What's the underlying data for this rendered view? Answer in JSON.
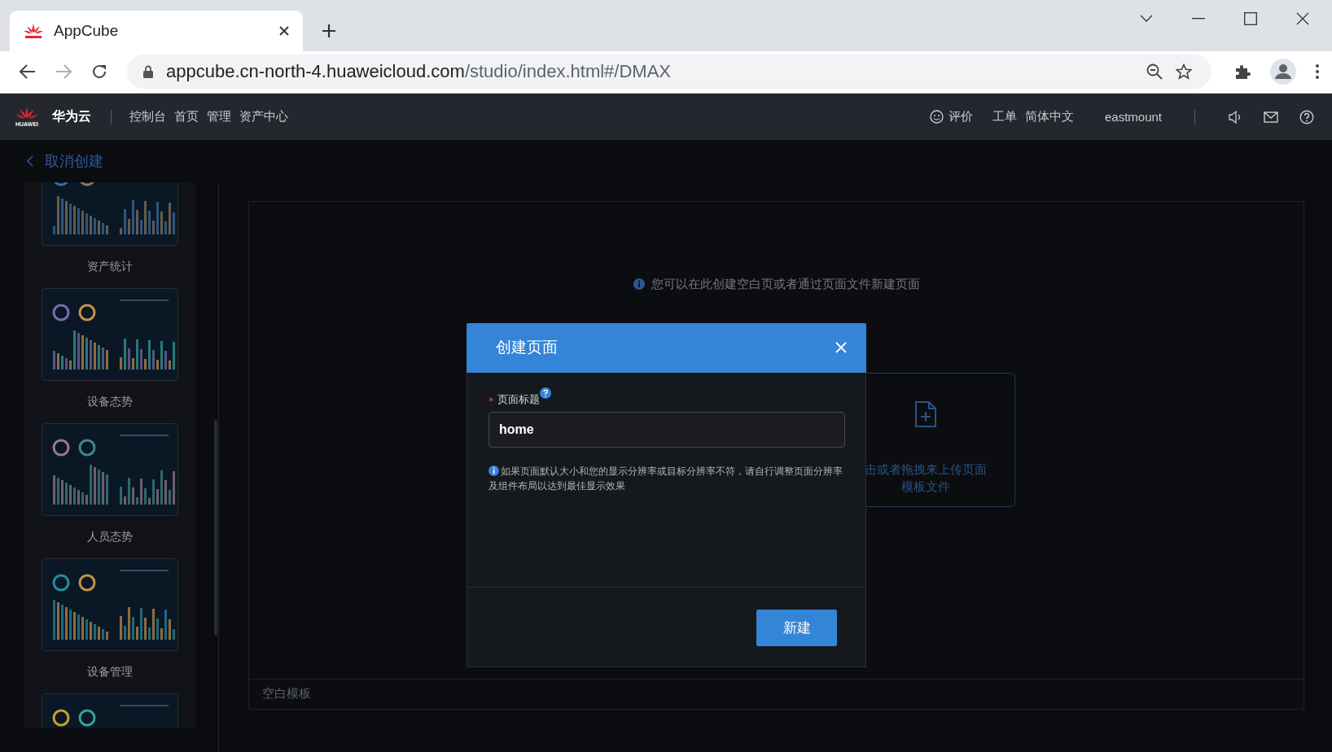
{
  "browser": {
    "tab_title": "AppCube",
    "url_host": "appcube.cn-north-4.huaweicloud.com",
    "url_path": "/studio/index.html#/DMAX",
    "forward_disabled": true
  },
  "header": {
    "brand": "华为云",
    "logo_text": "HUAWEI",
    "nav": [
      "控制台",
      "首页",
      "管理",
      "资产中心"
    ],
    "feedback": "评价",
    "ticket": "工单",
    "language": "简体中文",
    "user": "eastmount"
  },
  "back_link": "取消创建",
  "templates": [
    {
      "label": "资产统计"
    },
    {
      "label": "设备态势"
    },
    {
      "label": "人员态势"
    },
    {
      "label": "设备管理"
    }
  ],
  "main": {
    "info": "您可以在此创建空白页或者通过页面文件新建页面",
    "upload_lines": [
      "击或者拖拽来上传页面",
      "模板文件"
    ],
    "footer_label": "空白模板"
  },
  "dialog": {
    "title": "创建页面",
    "required_mark": "*",
    "field_label": "页面标题",
    "field_value": "home",
    "note": "如果页面默认大小和您的显示分辨率或目标分辨率不符，请自行调整页面分辨率及组件布局以达到最佳显示效果",
    "submit": "新建"
  }
}
